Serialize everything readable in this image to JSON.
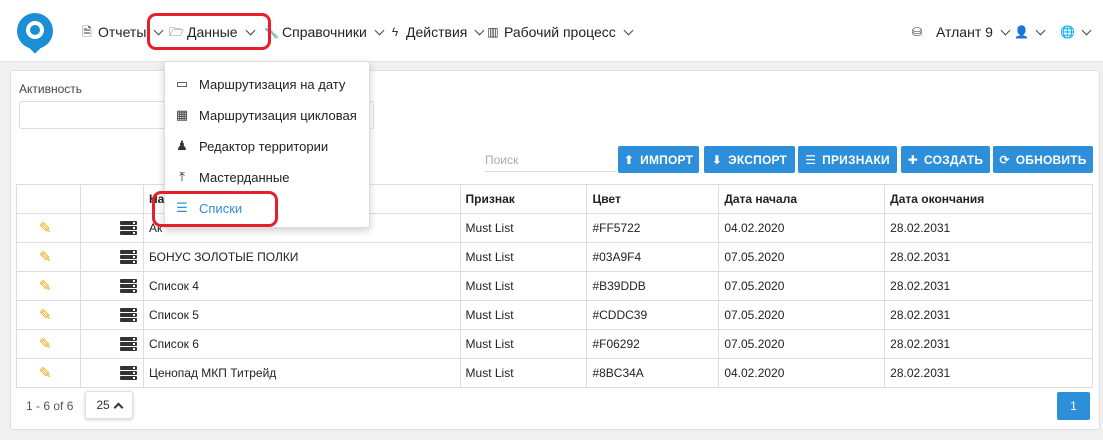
{
  "nav": {
    "reports": "Отчеты",
    "data": "Данные",
    "directories": "Справочники",
    "actions": "Действия",
    "workflow": "Рабочий процесс",
    "db": "Атлант 9"
  },
  "data_menu": [
    {
      "label": "Маршрутизация на дату",
      "icon": "calendar-icon"
    },
    {
      "label": "Маршрутизация цикловая",
      "icon": "calendar-grid-icon"
    },
    {
      "label": "Редактор территории",
      "icon": "person-pin-icon"
    },
    {
      "label": "Мастерданные",
      "icon": "upload-icon"
    },
    {
      "label": "Списки",
      "icon": "list-icon"
    }
  ],
  "filters": {
    "activity_label": "Активность",
    "search_placeholder": "Поиск"
  },
  "toolbar": {
    "import": "ИМПОРТ",
    "export": "ЭКСПОРТ",
    "features": "ПРИЗНАКИ",
    "create": "СОЗДАТЬ",
    "refresh": "ОБНОВИТЬ"
  },
  "table": {
    "headers": [
      "",
      "",
      "На",
      "Признак",
      "Цвет",
      "Дата начала",
      "Дата окончания"
    ],
    "rows": [
      {
        "name": "Ак",
        "feature": "Must List",
        "color": "#FF5722",
        "start": "04.02.2020",
        "end": "28.02.2031"
      },
      {
        "name": "БОНУС ЗОЛОТЫЕ ПОЛКИ",
        "feature": "Must List",
        "color": "#03A9F4",
        "start": "07.05.2020",
        "end": "28.02.2031"
      },
      {
        "name": "Список 4",
        "feature": "Must List",
        "color": "#B39DDB",
        "start": "07.05.2020",
        "end": "28.02.2031"
      },
      {
        "name": "Список 5",
        "feature": "Must List",
        "color": "#CDDC39",
        "start": "07.05.2020",
        "end": "28.02.2031"
      },
      {
        "name": "Список 6",
        "feature": "Must List",
        "color": "#F06292",
        "start": "07.05.2020",
        "end": "28.02.2031"
      },
      {
        "name": "Ценопад МКП Титрейд",
        "feature": "Must List",
        "color": "#8BC34A",
        "start": "04.02.2020",
        "end": "28.02.2031"
      }
    ]
  },
  "pagination": {
    "info": "1 - 6 of 6",
    "page_size": "25",
    "current_page": "1"
  },
  "colors": {
    "accent": "#2d8fd9",
    "highlight": "#e5202b",
    "edit_icon": "#f0a30a"
  }
}
